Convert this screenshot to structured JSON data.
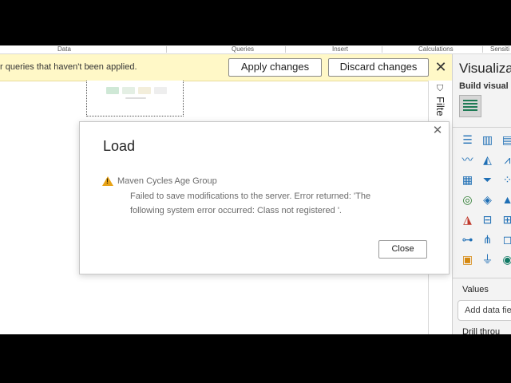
{
  "ribbon": {
    "groups": [
      "Data",
      "Queries",
      "Insert",
      "Calculations",
      "Sensiti"
    ]
  },
  "notification": {
    "message": "r queries that haven't been applied.",
    "apply_label": "Apply changes",
    "discard_label": "Discard changes",
    "close_icon": "close-icon"
  },
  "filters": {
    "label": "Filte"
  },
  "visualizations": {
    "title": "Visualizati",
    "build_label": "Build visual",
    "values_label": "Values",
    "add_field_placeholder": "Add data fie",
    "drill_label": "Drill throu"
  },
  "dialog": {
    "title": "Load",
    "query_name": "Maven Cycles Age Group",
    "error_message": "Failed to save modifications to the server. Error returned: 'The following system error occurred: Class not registered '.",
    "close_label": "Close"
  },
  "colors": {
    "warning_bar": "#fff8c7",
    "warning_icon": "#e8a317",
    "accent": "#1f6fb5"
  }
}
